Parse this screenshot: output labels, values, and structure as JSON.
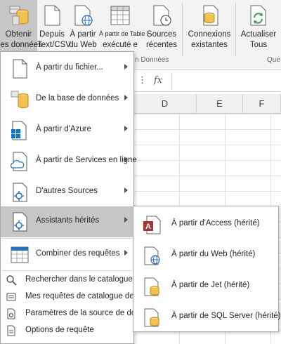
{
  "ribbon": {
    "buttons": [
      {
        "id": "get-data",
        "line1": "Obtenir",
        "line2": "des données",
        "icon": "database-icon"
      },
      {
        "id": "from-text",
        "line1": "Depuis",
        "line2": "Text/CSV",
        "icon": "document-icon"
      },
      {
        "id": "from-web",
        "line1": "À partir",
        "line2": "du Web",
        "icon": "globe-document-icon"
      },
      {
        "id": "from-table",
        "line1": "À partir de Table /",
        "line2": "exécuté e",
        "icon": "table-icon"
      },
      {
        "id": "recent-sources",
        "line1": "Sources",
        "line2": "récentes",
        "icon": "clock-document-icon"
      },
      {
        "id": "existing-connections",
        "line1": "Connexions",
        "line2": "existantes",
        "icon": "connections-icon"
      },
      {
        "id": "refresh-all",
        "line1": "Actualiser",
        "line2": "Tous",
        "icon": "refresh-icon"
      }
    ],
    "group_label_data": "n Données",
    "group_label_queries": "Que"
  },
  "formula_bar": {
    "more_glyph": "⋮",
    "fx_label": "fx"
  },
  "columns": [
    "D",
    "E",
    "F"
  ],
  "menu": {
    "items": [
      {
        "label": "À partir du fichier...",
        "icon": "file-icon",
        "has_submenu": true
      },
      {
        "label": "De la base de données",
        "icon": "database-icon",
        "has_submenu": true
      },
      {
        "label": "À partir d'Azure",
        "icon": "windows-azure-icon",
        "has_submenu": true
      },
      {
        "label": "À partir de Services en ligne",
        "icon": "cloud-icon",
        "has_submenu": true
      },
      {
        "label": "D'autres Sources",
        "icon": "other-sources-icon",
        "has_submenu": true
      },
      {
        "label": "Assistants hérités",
        "icon": "legacy-wizard-icon",
        "has_submenu": true
      },
      {
        "label": "Combiner des requêtes",
        "icon": "combine-queries-icon",
        "has_submenu": true
      }
    ],
    "small_items": [
      {
        "label": "Rechercher dans le catalogue de données",
        "icon": "search-catalog-icon"
      },
      {
        "label": "Mes requêtes de catalogue de données",
        "icon": "catalog-queries-icon"
      },
      {
        "label": "Paramètres de la source de données",
        "icon": "data-source-settings-icon"
      },
      {
        "label": "Options de requête",
        "icon": "query-options-icon"
      }
    ]
  },
  "submenu": {
    "items": [
      {
        "label": "À partir d'Access (hérité)",
        "icon": "access-icon"
      },
      {
        "label": "À partir du Web (hérité)",
        "icon": "web-legacy-icon"
      },
      {
        "label": "À partir de Jet (hérité)",
        "icon": "jet-database-icon"
      },
      {
        "label": "À partir de SQL Server (hérité)",
        "icon": "sql-server-icon"
      }
    ]
  },
  "colors": {
    "hover_bg": "#c6c6c6",
    "access_red": "#a4373a",
    "db_gold": "#f2c14e",
    "azure_blue": "#0078d4",
    "refresh_green": "#3a9a4a"
  }
}
